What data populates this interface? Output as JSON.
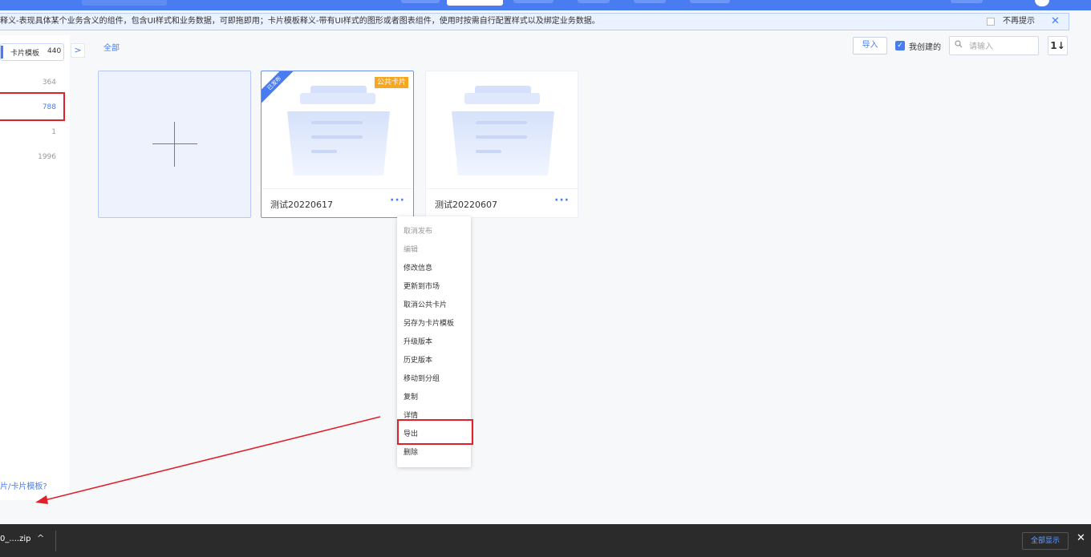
{
  "notice": {
    "text": "释义-表现具体某个业务含义的组件，包含UI样式和业务数据，可即拖即用；卡片模板释义-带有UI样式的图形或者图表组件，使用时按需自行配置样式以及绑定业务数据。",
    "dismiss_label": "不再提示",
    "close_glyph": "✕"
  },
  "sidebar": {
    "tab_label": "卡片模板",
    "tab_count": "440",
    "rows": [
      {
        "count": "364"
      },
      {
        "count": "788"
      },
      {
        "count": "1"
      },
      {
        "count": "1996"
      }
    ],
    "help_link": "片/卡片模板?"
  },
  "breadcrumb": "全部",
  "toolbar": {
    "import_label": "导入",
    "mine_checkbox_glyph": "✓",
    "mine_label": "我创建的",
    "search_placeholder": "请输入",
    "search_icon": "search-icon",
    "sort_glyph": "1↓"
  },
  "cards": [
    {
      "name": "测试20220617",
      "ribbon": "已发布",
      "badge": "公共卡片",
      "more": "···"
    },
    {
      "name": "测试20220607",
      "more": "···"
    }
  ],
  "context_menu": {
    "items": [
      {
        "label": "取消发布",
        "disabled": true
      },
      {
        "label": "编辑",
        "disabled": true
      },
      {
        "label": "修改信息"
      },
      {
        "label": "更新到市场"
      },
      {
        "label": "取消公共卡片"
      },
      {
        "label": "另存为卡片模板"
      },
      {
        "label": "升级版本"
      },
      {
        "label": "历史版本"
      },
      {
        "label": "移动到分组"
      },
      {
        "label": "复制"
      },
      {
        "label": "详情"
      },
      {
        "label": "导出"
      },
      {
        "label": "删除"
      }
    ]
  },
  "download_bar": {
    "file_name": "0_....zip",
    "show_all_label": "全部显示",
    "close_glyph": "✕"
  },
  "colors": {
    "accent": "#4a7cf1",
    "highlight": "#e0202a",
    "badge": "#f5a623"
  }
}
